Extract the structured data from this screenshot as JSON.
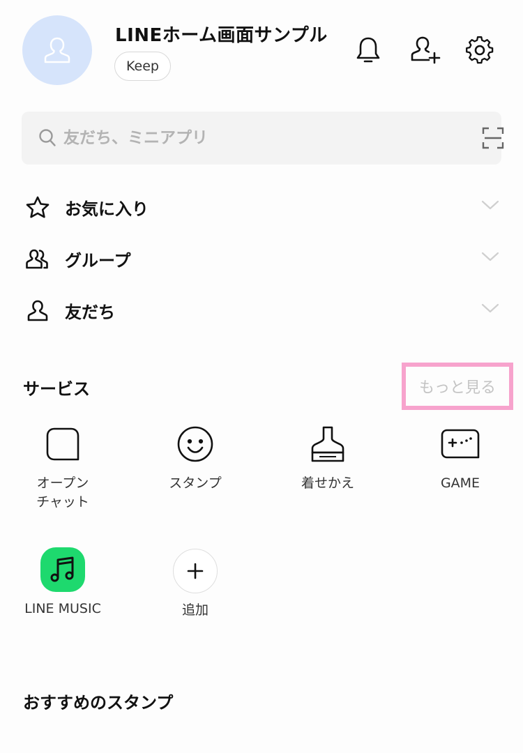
{
  "header": {
    "title": "LINEホーム画面サンプル",
    "keep_label": "Keep"
  },
  "search": {
    "placeholder": "友だち、ミニアプリ"
  },
  "lists": [
    {
      "label": "お気に入り",
      "icon": "star-icon"
    },
    {
      "label": "グループ",
      "icon": "group-icon"
    },
    {
      "label": "友だち",
      "icon": "person-icon"
    }
  ],
  "services": {
    "title": "サービス",
    "more_label": "もっと見る",
    "items": [
      {
        "label": "オープン\nチャット",
        "icon": "openchat-icon"
      },
      {
        "label": "スタンプ",
        "icon": "smiley-icon"
      },
      {
        "label": "着せかえ",
        "icon": "brush-icon"
      },
      {
        "label": "GAME",
        "icon": "gamepad-icon"
      },
      {
        "label": "LINE MUSIC",
        "icon": "music-note-icon"
      },
      {
        "label": "追加",
        "icon": "plus-icon"
      }
    ]
  },
  "recommended": {
    "title": "おすすめのスタンプ"
  },
  "colors": {
    "avatar_bg": "#d6e4fb",
    "music_green": "#1ed96e",
    "highlight_pink": "#f7a3cd"
  }
}
